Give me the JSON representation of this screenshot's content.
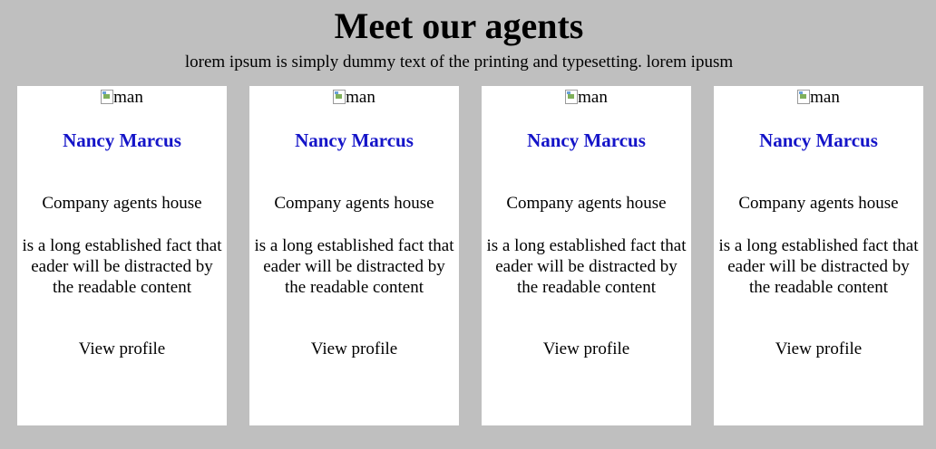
{
  "header": {
    "title": "Meet our agents",
    "subtitle": "lorem ipsum is simply dummy text of the printing and typesetting. lorem ipusm"
  },
  "agents": [
    {
      "image_alt": "man",
      "name": "Nancy Marcus",
      "company": "Company agents house",
      "description": "is a long established fact that eader will be distracted by the readable content",
      "view_label": "View profile"
    },
    {
      "image_alt": "man",
      "name": "Nancy Marcus",
      "company": "Company agents house",
      "description": "is a long established fact that eader will be distracted by the readable content",
      "view_label": "View profile"
    },
    {
      "image_alt": "man",
      "name": "Nancy Marcus",
      "company": "Company agents house",
      "description": "is a long established fact that eader will be distracted by the readable content",
      "view_label": "View profile"
    },
    {
      "image_alt": "man",
      "name": "Nancy Marcus",
      "company": "Company agents house",
      "description": "is a long established fact that eader will be distracted by the readable content",
      "view_label": "View profile"
    }
  ],
  "colors": {
    "background": "#bfbfbf",
    "card": "#ffffff",
    "name": "#1414c8"
  }
}
